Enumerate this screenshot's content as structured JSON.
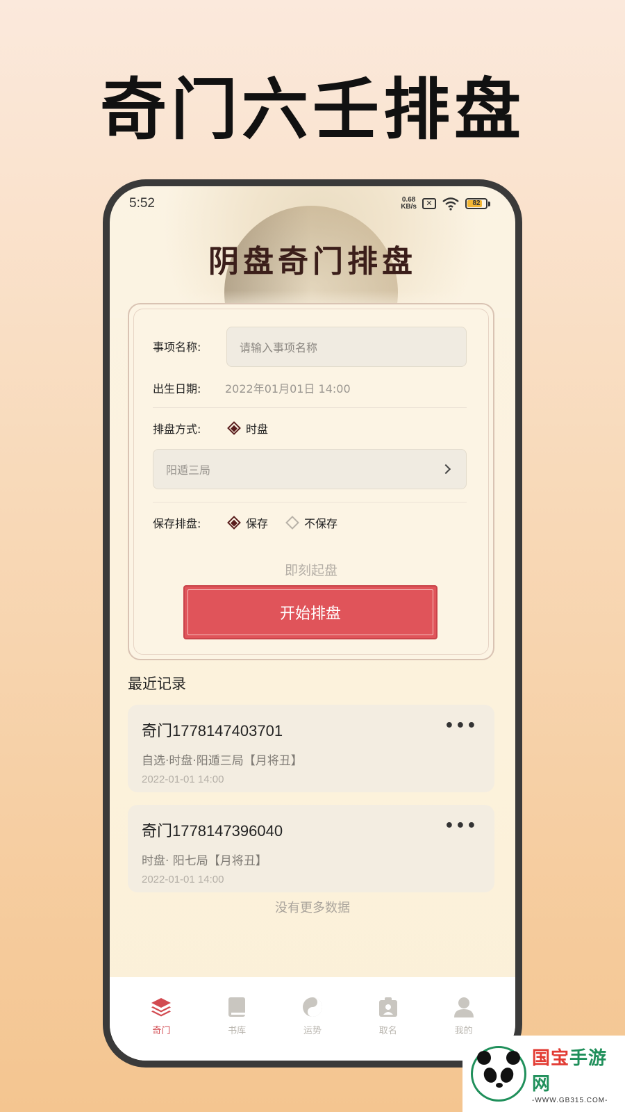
{
  "promo": {
    "title": "奇门六壬排盘"
  },
  "status_bar": {
    "time": "5:52",
    "net_speed_value": "0.68",
    "net_speed_unit": "KB/s",
    "battery": "82",
    "battery_level": 0.82
  },
  "app": {
    "title": "阴盘奇门排盘"
  },
  "form": {
    "item_name_label": "事项名称:",
    "item_name_placeholder": "请输入事项名称",
    "birth_date_label": "出生日期:",
    "birth_date_value": "2022年01月01日 14:00",
    "method_label": "排盘方式:",
    "method_option": "时盘",
    "ju_value": "阳遁三局",
    "save_label": "保存排盘:",
    "save_option_yes": "保存",
    "save_option_no": "不保存",
    "instant_text": "即刻起盘",
    "start_button": "开始排盘"
  },
  "recent": {
    "title": "最近记录",
    "records": [
      {
        "title": "奇门1778147403701",
        "desc": "自选·时盘·阳遁三局【月将丑】",
        "date": "2022-01-01 14:00"
      },
      {
        "title": "奇门1778147396040",
        "desc": "时盘· 阳七局【月将丑】",
        "date": "2022-01-01 14:00"
      }
    ],
    "no_more": "没有更多数据"
  },
  "tabs": [
    {
      "label": "奇门",
      "icon": "layers-icon",
      "active": true
    },
    {
      "label": "书库",
      "icon": "book-icon",
      "active": false
    },
    {
      "label": "运势",
      "icon": "taiji-icon",
      "active": false
    },
    {
      "label": "取名",
      "icon": "id-card-icon",
      "active": false
    },
    {
      "label": "我的",
      "icon": "user-icon",
      "active": false
    }
  ],
  "watermark": {
    "brand_part1": "国宝",
    "brand_part2": "手游网",
    "url": "-WWW.GB315.COM-"
  },
  "colors": {
    "accent": "#e0545a",
    "title_dark": "#3b1e1a",
    "brand_green": "#1f8f5a"
  }
}
